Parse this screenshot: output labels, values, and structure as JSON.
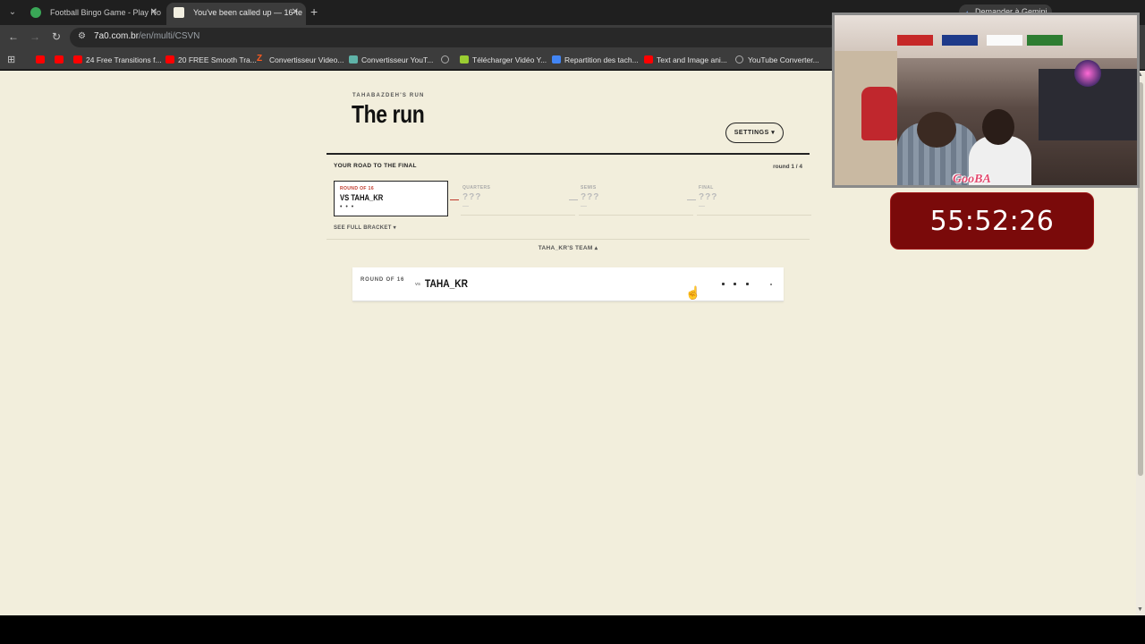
{
  "browser": {
    "tabs": [
      {
        "title": "Football Bingo Game - Play No",
        "active": false
      },
      {
        "title": "You've been called up — 16-te",
        "active": true
      }
    ],
    "gemini_label": "Demander à Gemini",
    "url_host": "7a0.com.br",
    "url_path": "/en/multi/CSVN",
    "bookmarks": [
      {
        "label": "",
        "icon": "youtube-icon"
      },
      {
        "label": "",
        "icon": "youtube-icon"
      },
      {
        "label": "24 Free Transitions f...",
        "icon": "youtube-icon"
      },
      {
        "label": "20 FREE Smooth Tra...",
        "icon": "youtube-icon"
      },
      {
        "label": "Convertisseur Video...",
        "icon": "z-icon"
      },
      {
        "label": "Convertisseur YouT...",
        "icon": "converter-icon"
      },
      {
        "label": "",
        "icon": "globe-icon"
      },
      {
        "label": "Télécharger Vidéo Y...",
        "icon": "download-icon"
      },
      {
        "label": "Repartition des tach...",
        "icon": "docs-icon"
      },
      {
        "label": "Text and Image ani...",
        "icon": "youtube-icon"
      },
      {
        "label": "YouTube Converter...",
        "icon": "globe-icon"
      }
    ]
  },
  "page": {
    "kicker": "TAHABAZDEH'S RUN",
    "title": "The run",
    "settings_label": "SETTINGS ▾",
    "road_label": "YOUR ROAD TO THE FINAL",
    "round_count": "round 1 / 4",
    "stages": [
      {
        "label": "ROUND OF 16",
        "opponent": "VS TAHA_KR",
        "status": "• • •",
        "current": true
      },
      {
        "label": "QUARTERS",
        "opponent": "???",
        "status": "—",
        "current": false
      },
      {
        "label": "SEMIS",
        "opponent": "???",
        "status": "—",
        "current": false
      },
      {
        "label": "FINAL",
        "opponent": "???",
        "status": "—",
        "current": false
      }
    ],
    "see_bracket": "SEE FULL BRACKET ▾",
    "team_toggle": "TAHA_KR'S TEAM ▴",
    "match": {
      "round_label": "ROUND OF 16",
      "vs_label": "vs",
      "opponent": "TAHA_KR"
    }
  },
  "overlay": {
    "cam_logo": "GooBA",
    "timer": "55:52:26"
  },
  "colors": {
    "page_bg": "#f2eedc",
    "accent_red": "#c0392b",
    "timer_bg": "#7a0a0a"
  }
}
